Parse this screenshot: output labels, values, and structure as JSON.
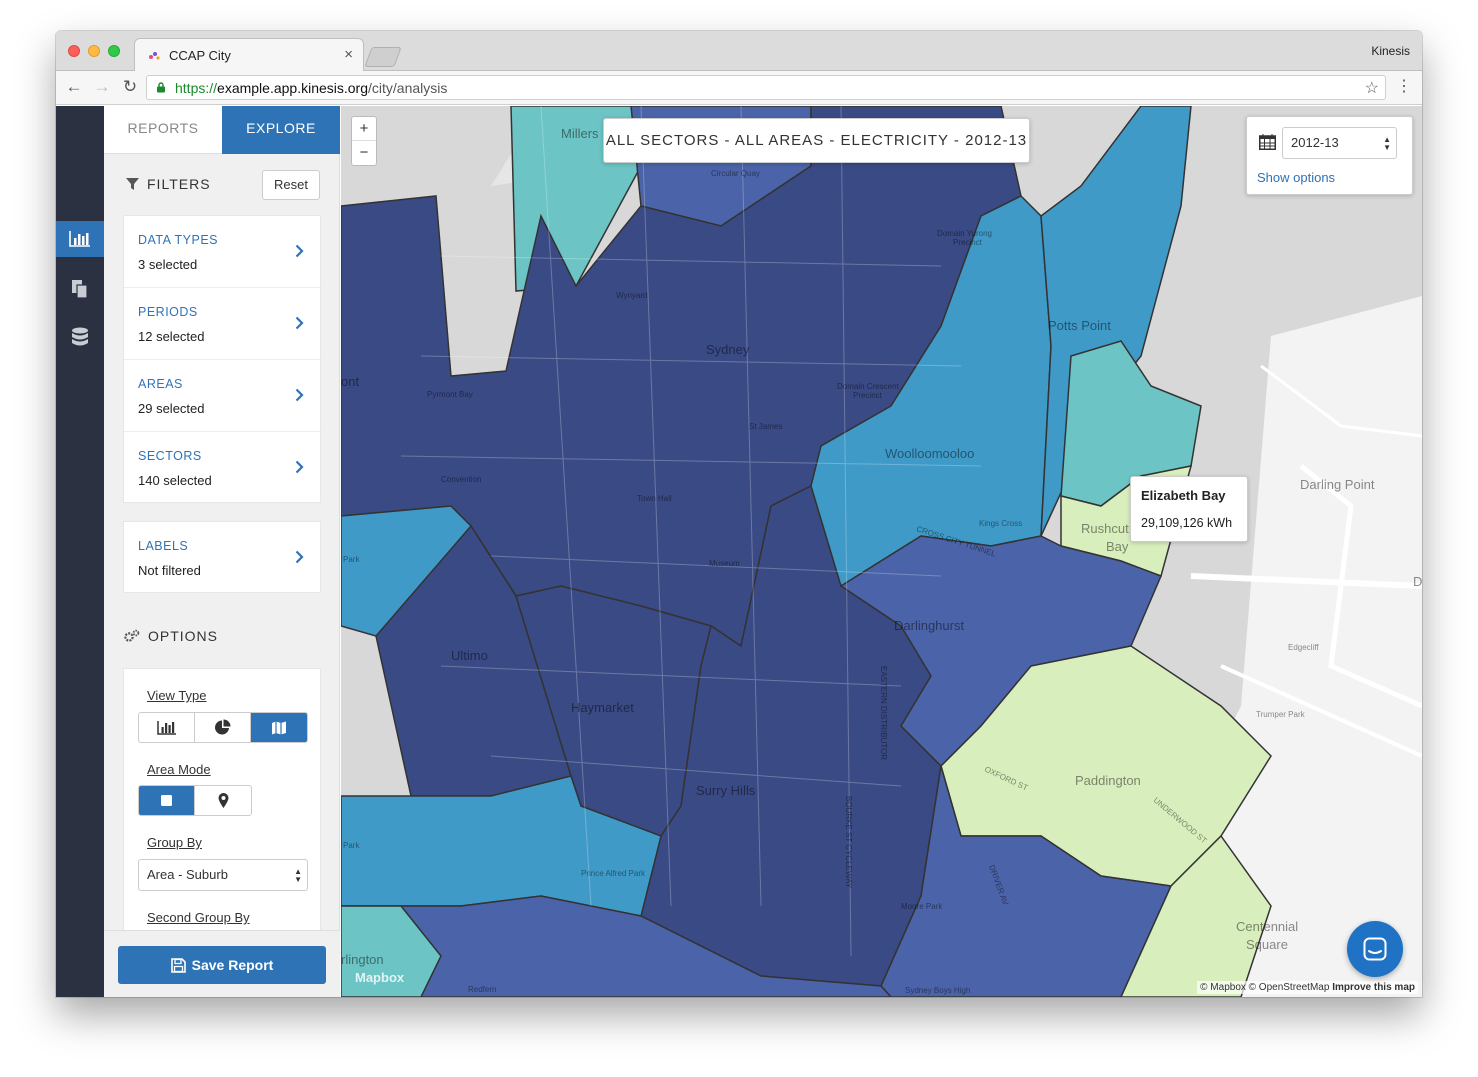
{
  "browser": {
    "tab_title": "CCAP City",
    "profile": "Kinesis",
    "url_scheme": "https://",
    "url_host": "example.app.kinesis.org",
    "url_path": "/city/analysis"
  },
  "sidebar": {
    "tabs": [
      {
        "label": "REPORTS",
        "active": false
      },
      {
        "label": "EXPLORE",
        "active": true
      }
    ],
    "filters_heading": "FILTERS",
    "reset_label": "Reset",
    "filters": [
      {
        "title": "DATA TYPES",
        "value": "3 selected"
      },
      {
        "title": "PERIODS",
        "value": "12 selected"
      },
      {
        "title": "AREAS",
        "value": "29 selected"
      },
      {
        "title": "SECTORS",
        "value": "140 selected"
      }
    ],
    "labels": {
      "title": "LABELS",
      "value": "Not filtered"
    },
    "options_heading": "OPTIONS",
    "view_type": {
      "label": "View Type",
      "options": [
        "bar-chart-icon",
        "pie-chart-icon",
        "map-icon"
      ],
      "selected": "map-icon"
    },
    "area_mode": {
      "label": "Area Mode",
      "options": [
        "square-icon",
        "map-pin-icon"
      ],
      "selected": "square-icon"
    },
    "group_by": {
      "label": "Group By",
      "value": "Area - Suburb"
    },
    "second_group_by": {
      "label": "Second Group By"
    },
    "save_label": "Save Report"
  },
  "rail": {
    "items": [
      "bar-chart-icon",
      "documents-icon",
      "database-icon"
    ],
    "active": "bar-chart-icon"
  },
  "map": {
    "title": "ALL SECTORS - ALL AREAS - ELECTRICITY - 2012-13",
    "period_value": "2012-13",
    "show_options": "Show options",
    "zoom_in": "+",
    "zoom_out": "−",
    "tooltip": {
      "area": "Elizabeth Bay",
      "value": "29,109,126 kWh"
    },
    "attribution_a": "© Mapbox © OpenStreetMap",
    "attribution_b": "Improve this map",
    "logo": "Mapbox",
    "place_labels": {
      "millers": "Millers",
      "circular_quay": "Circular Quay",
      "wynyard": "Wynyard",
      "sydney": "Sydney",
      "domain_yurong": "Domain Yurong",
      "precinct_a": "Precinct",
      "domain_crescent": "Domain Crescent",
      "precinct_b": "Precinct",
      "st_james": "St James",
      "pyrmont": "ont",
      "pyrmont_bay": "Pyrmont Bay",
      "convention": "Convention",
      "town_hall": "Town Hall",
      "museum": "Museum",
      "potts_point": "Potts Point",
      "woolloomooloo": "Woolloomooloo",
      "kings_cross": "Kings Cross",
      "cross_city_tunnel": "CROSS CITY TUNNEL",
      "rushcutters": "Rushcut",
      "bay": "Bay",
      "darling_point": "Darling Point",
      "darlinghurst": "Darlinghurst",
      "edgecliff": "Edgecliff",
      "trumper_park": "Trumper Park",
      "paddington": "Paddington",
      "oxford_st": "OXFORD ST",
      "underwood_st": "UNDERWOOD ST",
      "ultimo": "Ultimo",
      "haymarket": "Haymarket",
      "surry_hills": "Surry Hills",
      "prince_alfred_park": "Prince Alfred Park",
      "moore_park": "Moore Park",
      "park_a": "Park",
      "park_b": "Park",
      "centennial": "Centennial",
      "square": "Square",
      "redfern": "Redfern",
      "sydney_boys_high": "Sydney Boys High",
      "darlington": "rlington",
      "eastern_distributor": "EASTERN DISTRIBUTOR",
      "bourke_st_cycleway": "BOURKE ST CYCLEWAY",
      "driver_av": "DRIVER AV",
      "d_edge": "D"
    }
  },
  "colors": {
    "accent": "#2f73b7",
    "rail": "#2b3141",
    "choropleth_darkest": "#3a4a85",
    "choropleth_dark": "#4b63a8",
    "choropleth_mid": "#3f9ac8",
    "choropleth_teal": "#6cc4c4",
    "choropleth_light": "#d9eebd"
  }
}
